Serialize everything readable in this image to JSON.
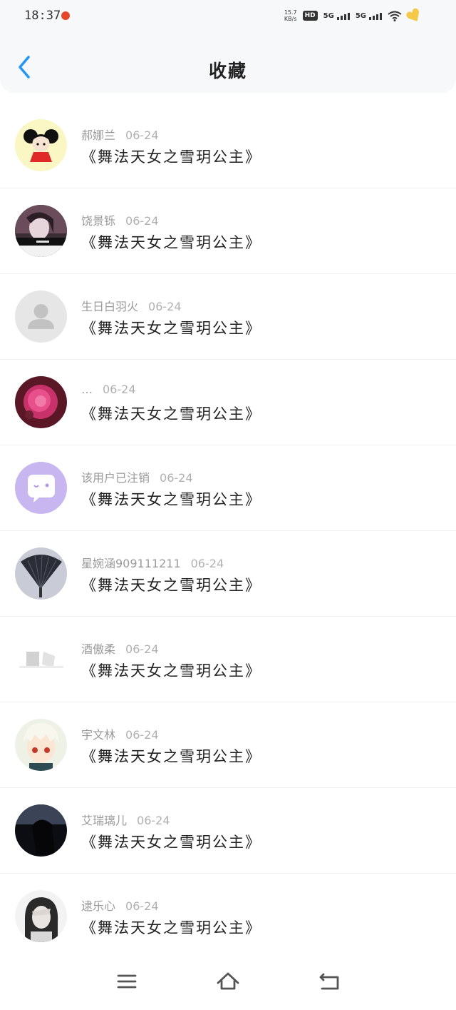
{
  "status": {
    "time": "18:37",
    "net_speed_value": "15.7",
    "net_speed_unit": "KB/s",
    "hd_label": "HD",
    "sim1_label": "5G",
    "sim2_label": "5G"
  },
  "header": {
    "title": "收藏"
  },
  "items": [
    {
      "name": "郝娜兰",
      "date": "06-24",
      "title": "《舞法天女之雪玥公主》",
      "avatar": "cartoon-girl-avatar"
    },
    {
      "name": "饶景铄",
      "date": "06-24",
      "title": "《舞法天女之雪玥公主》",
      "avatar": "dark-portrait-avatar"
    },
    {
      "name": "生日白羽火",
      "date": "06-24",
      "title": "《舞法天女之雪玥公主》",
      "avatar": "default-user-avatar"
    },
    {
      "name": "…",
      "date": "06-24",
      "title": "《舞法天女之雪玥公主》",
      "avatar": "pink-flower-avatar"
    },
    {
      "name": "该用户已注销",
      "date": "06-24",
      "title": "《舞法天女之雪玥公主》",
      "avatar": "deleted-user-avatar"
    },
    {
      "name": "星婉涵909111211",
      "date": "06-24",
      "title": "《舞法天女之雪玥公主》",
      "avatar": "fan-avatar"
    },
    {
      "name": "酒傲柔",
      "date": "06-24",
      "title": "《舞法天女之雪玥公主》",
      "avatar": "faded-sketch-avatar"
    },
    {
      "name": "宇文林",
      "date": "06-24",
      "title": "《舞法天女之雪玥公主》",
      "avatar": "anime-boy-avatar"
    },
    {
      "name": "艾瑞璃儿",
      "date": "06-24",
      "title": "《舞法天女之雪玥公主》",
      "avatar": "dark-girl-avatar"
    },
    {
      "name": "逮乐心",
      "date": "06-24",
      "title": "《舞法天女之雪玥公主》",
      "avatar": "bw-girl-avatar"
    }
  ],
  "colors": {
    "accent": "#2196f3",
    "header_bg": "#f7f8fa",
    "text_primary": "#222222",
    "text_secondary": "#9a9a9a"
  },
  "nav": {
    "menu_icon": "menu-icon",
    "home_icon": "home-icon",
    "back_icon": "back-return-icon"
  }
}
